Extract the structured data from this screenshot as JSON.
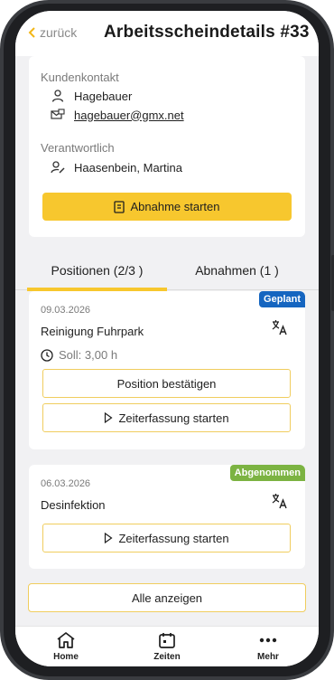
{
  "header": {
    "back_label": "zurück",
    "title": "Arbeitsscheindetails #33"
  },
  "contact": {
    "section_label": "Kundenkontakt",
    "name": "Hagebauer",
    "email": "hagebauer@gmx.net"
  },
  "responsible": {
    "section_label": "Verantwortlich",
    "name": "Haasenbein, Martina"
  },
  "abnahme_button": "Abnahme starten",
  "tabs": [
    {
      "label": "Positionen (2/3 )",
      "active": true
    },
    {
      "label": "Abnahmen (1 )",
      "active": false
    }
  ],
  "positions": [
    {
      "status": "Geplant",
      "status_color": "#1565c0",
      "date": "09.03.2026",
      "name": "Reinigung Fuhrpark",
      "soll": "Soll: 3,00 h",
      "confirm_button": "Position bestätigen",
      "time_button": "Zeiterfassung starten"
    },
    {
      "status": "Abgenommen",
      "status_color": "#7cb342",
      "date": "06.03.2026",
      "name": "Desinfektion",
      "time_button": "Zeiterfassung starten"
    }
  ],
  "show_all_button": "Alle anzeigen",
  "bottom_nav": [
    {
      "label": "Home",
      "icon": "home-icon"
    },
    {
      "label": "Zeiten",
      "icon": "calendar-icon"
    },
    {
      "label": "Mehr",
      "icon": "more-icon"
    }
  ],
  "colors": {
    "accent": "#f7c72e",
    "background": "#f1f1f3"
  }
}
